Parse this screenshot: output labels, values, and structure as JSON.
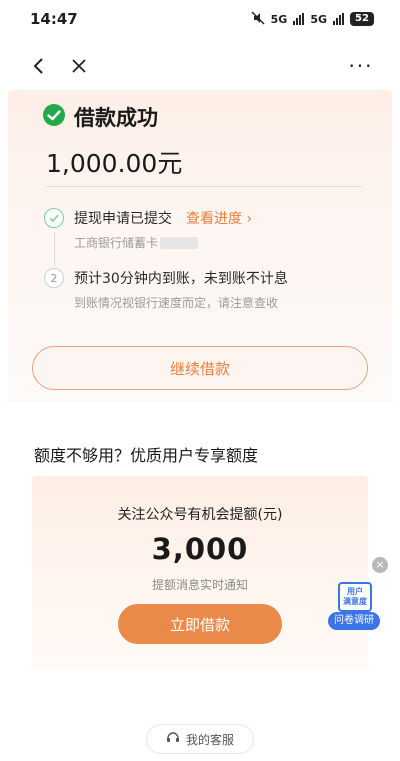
{
  "status_bar": {
    "time": "14:47",
    "network": "5G",
    "battery": "52"
  },
  "nav": {
    "back_icon": "chevron-left-icon",
    "close_icon": "close-icon",
    "more_label": "···"
  },
  "success": {
    "title": "借款成功",
    "amount": "1,000.00元",
    "step1": {
      "text": "提现申请已提交",
      "link": "查看进度 ›",
      "sub": "工商银行储蓄卡"
    },
    "step2": {
      "number": "2",
      "text": "预计30分钟内到账，未到账不计息",
      "sub": "到账情况视银行速度而定，请注意查收"
    }
  },
  "continue_button": "继续借款",
  "promo": {
    "heading": "额度不够用？优质用户专享额度",
    "subtitle": "关注公众号有机会提额(元)",
    "amount": "3,000",
    "note": "提额消息实时通知",
    "button": "立即借款"
  },
  "survey": {
    "close": "×",
    "icon_text": "用户\n满意度",
    "label": "问卷调研"
  },
  "service": {
    "label": "我的客服"
  },
  "colors": {
    "accent": "#e8803a",
    "success": "#23a84c",
    "survey": "#3c74e6"
  }
}
